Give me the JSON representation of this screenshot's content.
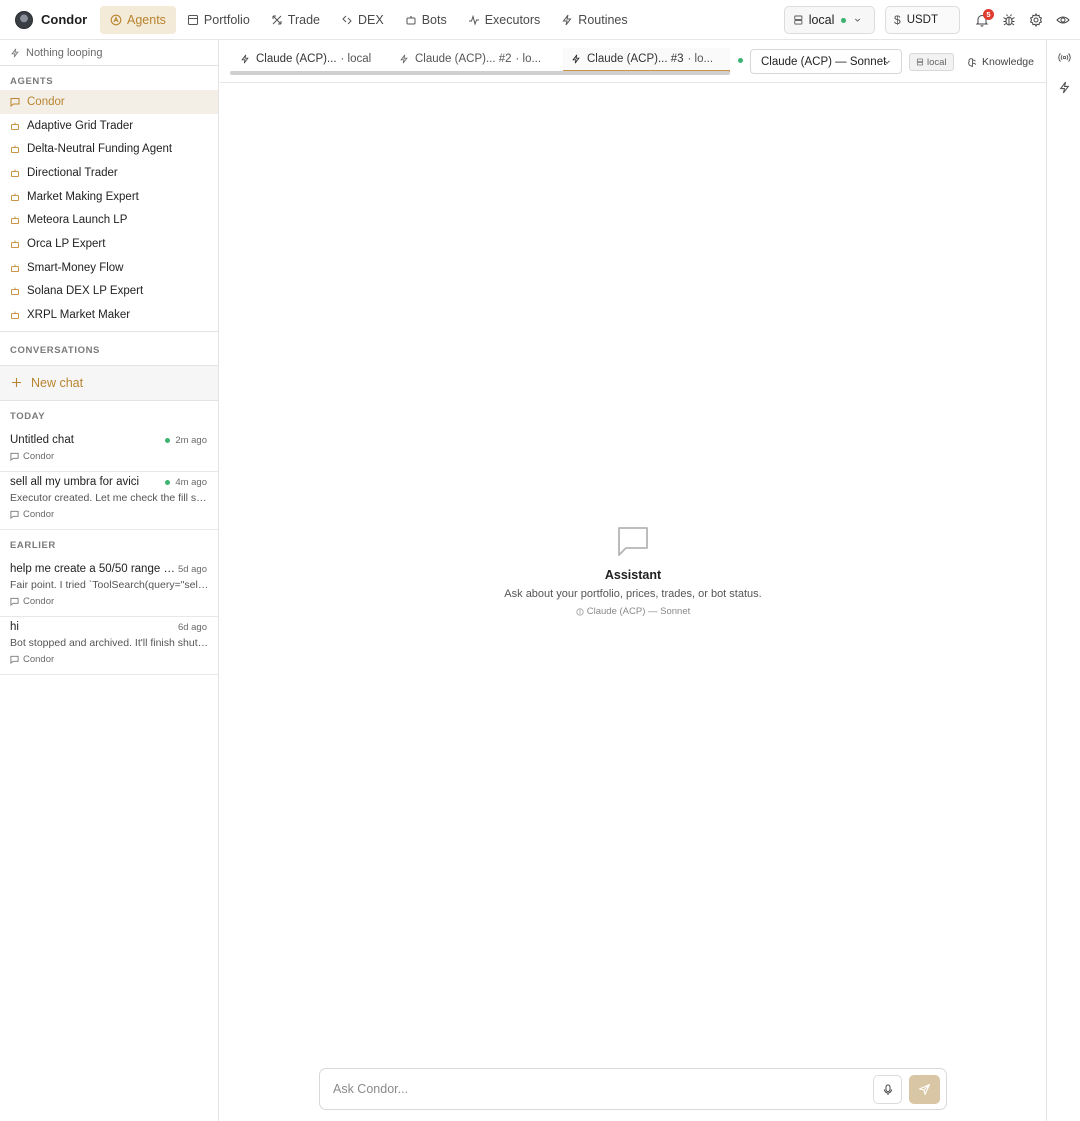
{
  "app": {
    "name": "Condor"
  },
  "nav": {
    "items": [
      {
        "label": "Agents",
        "icon": "agents-icon",
        "active": true
      },
      {
        "label": "Portfolio",
        "icon": "portfolio-icon"
      },
      {
        "label": "Trade",
        "icon": "trade-icon"
      },
      {
        "label": "DEX",
        "icon": "dex-icon"
      },
      {
        "label": "Bots",
        "icon": "bots-icon"
      },
      {
        "label": "Executors",
        "icon": "executors-icon"
      },
      {
        "label": "Routines",
        "icon": "routines-icon"
      }
    ]
  },
  "topright": {
    "server": "local",
    "currency": "USDT",
    "notifications": "5"
  },
  "sidebar": {
    "loop_status": "Nothing looping",
    "agents_label": "AGENTS",
    "agents": [
      "Condor",
      "Adaptive Grid Trader",
      "Delta-Neutral Funding Agent",
      "Directional Trader",
      "Market Making Expert",
      "Meteora Launch LP",
      "Orca LP Expert",
      "Smart-Money Flow",
      "Solana DEX LP Expert",
      "XRPL Market Maker"
    ],
    "conversations_label": "CONVERSATIONS",
    "new_chat": "New chat",
    "today_label": "TODAY",
    "earlier_label": "EARLIER",
    "today": [
      {
        "title": "Untitled chat",
        "time": "2m ago",
        "preview": "",
        "agent": "Condor",
        "live": true
      },
      {
        "title": "sell all my umbra for avici",
        "time": "4m ago",
        "preview": "Executor created. Let me check the fill status...",
        "agent": "Condor",
        "live": true
      }
    ],
    "earlier": [
      {
        "title": "help me create a 50/50 range in...",
        "time": "5d ago",
        "preview": "Fair point. I tried `ToolSearch(query=\"select:...",
        "agent": "Condor"
      },
      {
        "title": "hi",
        "time": "6d ago",
        "preview": "Bot stopped and archived. It'll finish shutting down...",
        "agent": "Condor"
      }
    ]
  },
  "tabs": {
    "items": [
      {
        "name": "Claude (ACP)...",
        "suffix": "· local"
      },
      {
        "name": "Claude (ACP)... #2",
        "suffix": "· lo..."
      },
      {
        "name": "Claude (ACP)... #3",
        "suffix": "· lo...",
        "active": true
      }
    ],
    "model": "Claude (ACP) — Sonnet",
    "env": "local",
    "knowledge": "Knowledge"
  },
  "empty_state": {
    "title": "Assistant",
    "subtitle": "Ask about your portfolio, prices, trades, or bot status.",
    "model": "Claude (ACP) — Sonnet"
  },
  "composer": {
    "placeholder": "Ask Condor..."
  },
  "colors": {
    "accent": "#b8842f",
    "live": "#3cb371",
    "badge": "#e03b2f"
  }
}
